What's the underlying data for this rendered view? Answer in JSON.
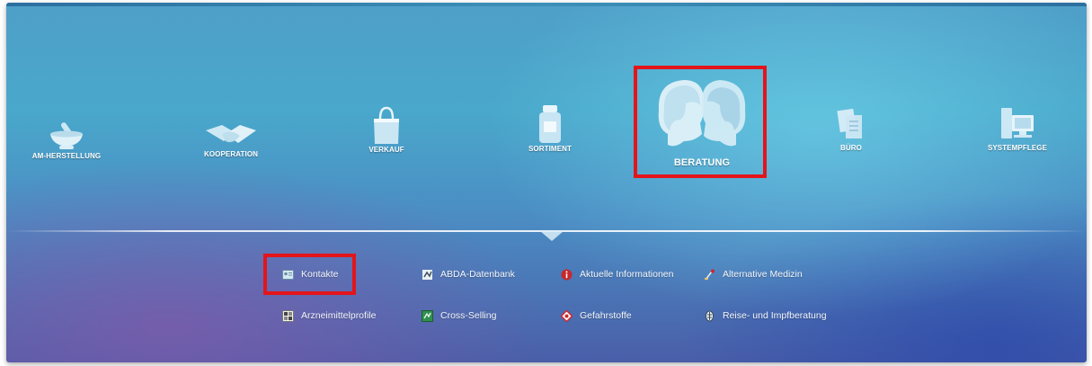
{
  "categories": [
    {
      "id": "am-herstellung",
      "label": "AM-HERSTELLUNG",
      "icon": "mortar-pestle-icon"
    },
    {
      "id": "kooperation",
      "label": "KOOPERATION",
      "icon": "handshake-icon"
    },
    {
      "id": "verkauf",
      "label": "VERKAUF",
      "icon": "shopping-bag-icon"
    },
    {
      "id": "sortiment",
      "label": "SORTIMENT",
      "icon": "medicine-jar-icon"
    },
    {
      "id": "beratung",
      "label": "BERATUNG",
      "icon": "consultation-heads-icon",
      "selected": true
    },
    {
      "id": "buero",
      "label": "BÜRO",
      "icon": "documents-icon"
    },
    {
      "id": "systempflege",
      "label": "SYSTEMPFLEGE",
      "icon": "computer-icon"
    }
  ],
  "submenu": [
    {
      "label": "Kontakte",
      "icon": "contact-card-icon",
      "highlighted": true
    },
    {
      "label": "ABDA-Datenbank",
      "icon": "database-icon"
    },
    {
      "label": "Aktuelle Informationen",
      "icon": "info-icon"
    },
    {
      "label": "Alternative Medizin",
      "icon": "herb-icon"
    },
    {
      "label": "Arzneimittelprofile",
      "icon": "profile-grid-icon"
    },
    {
      "label": "Cross-Selling",
      "icon": "cross-selling-icon"
    },
    {
      "label": "Gefahrstoffe",
      "icon": "hazard-icon"
    },
    {
      "label": "Reise- und Impfberatung",
      "icon": "vaccination-icon"
    }
  ],
  "colors": {
    "highlight": "#e3151b",
    "label": "#ffffff"
  }
}
